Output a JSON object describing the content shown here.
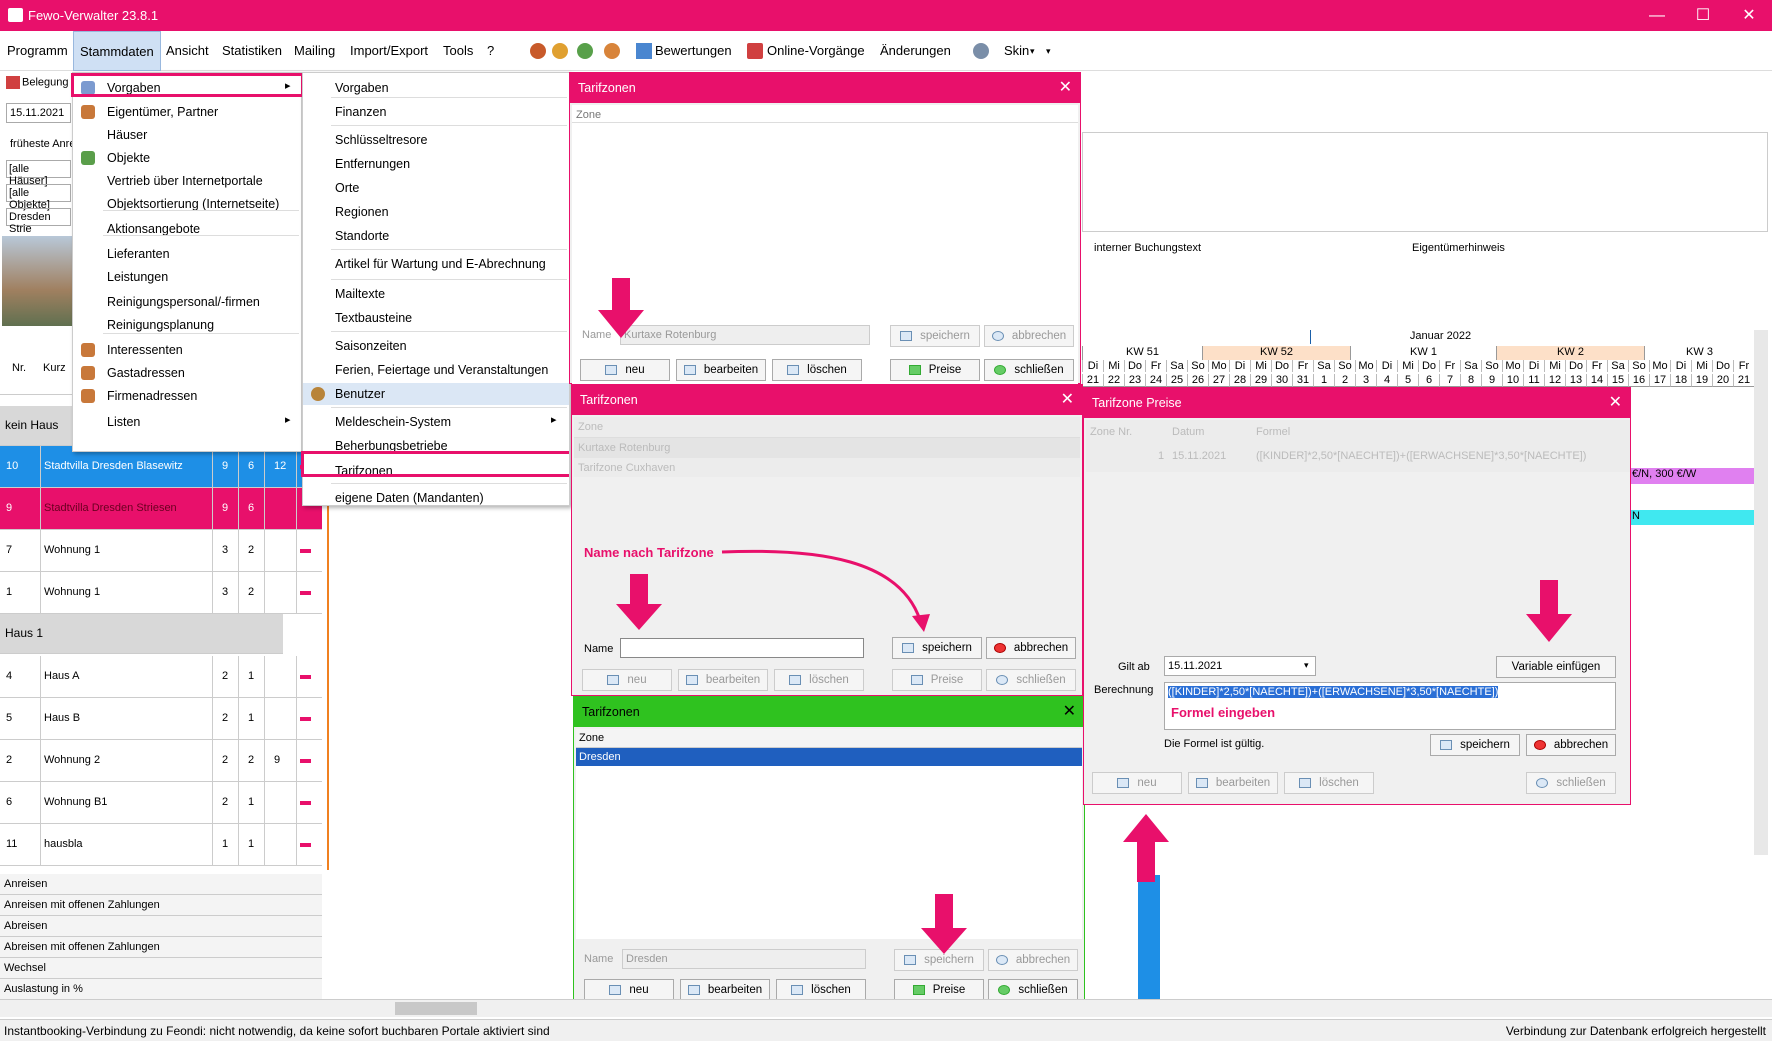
{
  "window": {
    "title": "Fewo-Verwalter 23.8.1",
    "min": "—",
    "max": "☐",
    "close": "✕"
  },
  "menubar": {
    "items": [
      "Programm",
      "Stammdaten",
      "Ansicht",
      "Statistiken",
      "Mailing",
      "Import/Export",
      "Tools",
      "?"
    ],
    "bewertungen": "Bewertungen",
    "online": "Online-Vorgänge",
    "aenderungen": "Änderungen",
    "skin": "Skin"
  },
  "toolbar": {
    "belegung": "Belegung",
    "date": "15.11.2021",
    "frueheste": "früheste Anre",
    "alle_haeuser": "[alle Häuser]",
    "alle_objekte": "[alle Objekte]",
    "ort": "Dresden Strie"
  },
  "stammdaten_menu": [
    "Vorgaben",
    "Eigentümer, Partner",
    "Häuser",
    "Objekte",
    "Vertrieb über Internetportale",
    "Objektsortierung (Internetseite)",
    "Aktionsangebote",
    "Lieferanten",
    "Leistungen",
    "Reinigungspersonal/-firmen",
    "Reinigungsplanung",
    "Interessenten",
    "Gastadressen",
    "Firmenadressen",
    "Listen"
  ],
  "vorgaben_menu": [
    "Vorgaben",
    "Finanzen",
    "Schlüsseltresore",
    "Entfernungen",
    "Orte",
    "Regionen",
    "Standorte",
    "Artikel für Wartung und E-Abrechnung",
    "Mailtexte",
    "Textbausteine",
    "Saisonzeiten",
    "Ferien, Feiertage und Veranstaltungen",
    "Benutzer",
    "Meldeschein-System",
    "Beherbungsbetriebe",
    "Tarifzonen",
    "eigene Daten (Mandanten)"
  ],
  "grid": {
    "col_nr": "Nr.",
    "col_kurz": "Kurz",
    "groups": [
      "kein Haus",
      "Haus 1"
    ],
    "rows": [
      [
        "10",
        "Stadtvilla Dresden Blasewitz",
        "9",
        "6",
        "12"
      ],
      [
        "9",
        "Stadtvilla Dresden Striesen",
        "9",
        "6",
        ""
      ],
      [
        "7",
        "Wohnung 1",
        "3",
        "2",
        ""
      ],
      [
        "1",
        "Wohnung 1",
        "3",
        "2",
        ""
      ],
      [
        "4",
        "Haus A",
        "2",
        "1",
        ""
      ],
      [
        "5",
        "Haus B",
        "2",
        "1",
        ""
      ],
      [
        "2",
        "Wohnung 2",
        "2",
        "2",
        "9"
      ],
      [
        "6",
        "Wohnung B1",
        "2",
        "1",
        ""
      ],
      [
        "11",
        "hausbla",
        "1",
        "1",
        ""
      ]
    ],
    "stats": [
      "Anreisen",
      "Anreisen mit offenen Zahlungen",
      "Abreisen",
      "Abreisen mit offenen Zahlungen",
      "Wechsel",
      "Auslastung in %"
    ]
  },
  "calendar": {
    "month": "Januar 2022",
    "weeks": [
      "KW 51",
      "KW 52",
      "KW 1",
      "KW 2",
      "KW 3"
    ],
    "days": [
      "Di",
      "Mi",
      "Do",
      "Fr",
      "Sa",
      "So",
      "Mo",
      "Di",
      "Mi",
      "Do",
      "Fr",
      "Sa",
      "So",
      "Mo",
      "Di",
      "Mi",
      "Do",
      "Fr",
      "Sa",
      "So",
      "Mo",
      "Di",
      "Mi",
      "Do",
      "Fr",
      "Sa",
      "So",
      "Mo",
      "Di",
      "Mi",
      "Do",
      "Fr"
    ],
    "dates": [
      "21",
      "22",
      "23",
      "24",
      "25",
      "26",
      "27",
      "28",
      "29",
      "30",
      "31",
      "1",
      "2",
      "3",
      "4",
      "5",
      "6",
      "7",
      "8",
      "9",
      "10",
      "11",
      "12",
      "13",
      "14",
      "15",
      "16",
      "17",
      "18",
      "19",
      "20",
      "21"
    ],
    "interner": "interner Buchungstext",
    "eigentuemer": "Eigentümerhinweis",
    "bar1": "€/N, 300 €/W",
    "bar2": "N"
  },
  "dlg1": {
    "title": "Tarifzonen",
    "col": "Zone",
    "name_label": "Name",
    "name_value": "Kurtaxe Rotenburg",
    "speichern": "speichern",
    "abbrechen": "abbrechen",
    "neu": "neu",
    "bearbeiten": "bearbeiten",
    "loeschen": "löschen",
    "preise": "Preise",
    "schliessen": "schließen"
  },
  "dlg2": {
    "title": "Tarifzonen",
    "col": "Zone",
    "rows": [
      "Kurtaxe Rotenburg",
      "Tarifzone Cuxhaven"
    ],
    "annotation": "Name nach Tarifzone",
    "name_label": "Name"
  },
  "dlg3": {
    "title": "Tarifzonen",
    "col": "Zone",
    "rows": [
      "Dresden"
    ],
    "name_label": "Name",
    "name_value": "Dresden"
  },
  "dlg4": {
    "title": "Tarifzone Preise",
    "cols": [
      "Zone Nr.",
      "Datum",
      "Formel"
    ],
    "row": [
      "1",
      "15.11.2021",
      "([KINDER]*2,50*[NAECHTE])+([ERWACHSENE]*3,50*[NAECHTE])"
    ],
    "gilt_ab": "Gilt ab",
    "gilt_value": "15.11.2021",
    "variable": "Variable einfügen",
    "berechnung": "Berechnung",
    "formel": "([KINDER]*2,50*[NAECHTE])+([ERWACHSENE]*3,50*[NAECHTE])",
    "formel_hint": "Formel eingeben",
    "valid": "Die Formel ist gültig."
  },
  "status": {
    "left": "Instantbooking-Verbindung zu Feondi: nicht notwendig, da keine sofort buchbaren Portale aktiviert sind",
    "right": "Verbindung zur Datenbank erfolgreich hergestellt"
  },
  "colors": {
    "accent": "#e8106b",
    "selected": "#1e8fe6",
    "green": "#2fc21f"
  }
}
